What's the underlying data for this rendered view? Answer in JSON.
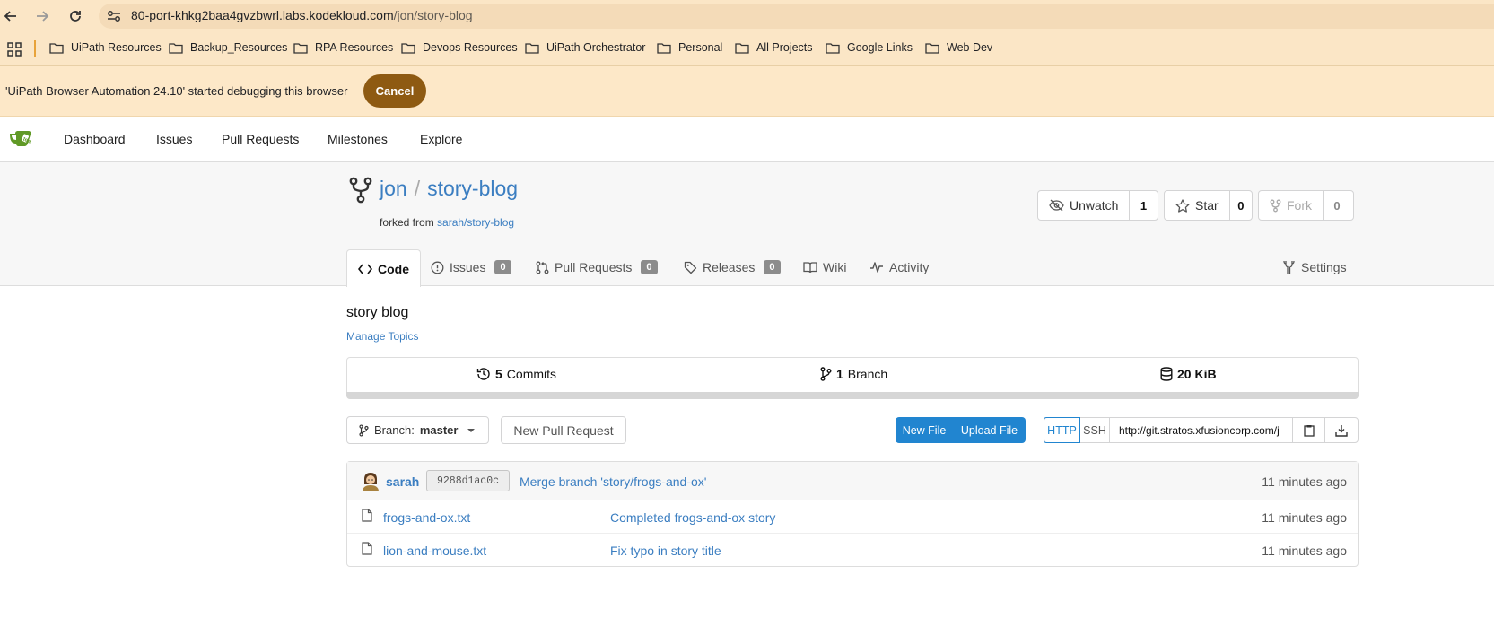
{
  "browser": {
    "url_host": "80-port-khkg2baa4gvzbwrl.labs.kodekloud.com",
    "url_path": "/jon/story-blog",
    "bookmarks": [
      {
        "label": "UiPath Resources"
      },
      {
        "label": "Backup_Resources"
      },
      {
        "label": "RPA Resources"
      },
      {
        "label": "Devops Resources"
      },
      {
        "label": "UiPath Orchestrator"
      },
      {
        "label": "Personal"
      },
      {
        "label": "All Projects"
      },
      {
        "label": "Google Links"
      },
      {
        "label": "Web Dev"
      }
    ],
    "infobar_text": "'UiPath Browser Automation 24.10' started debugging this browser",
    "infobar_cancel": "Cancel"
  },
  "nav": {
    "items": [
      "Dashboard",
      "Issues",
      "Pull Requests",
      "Milestones",
      "Explore"
    ]
  },
  "repo": {
    "owner": "jon",
    "name": "story-blog",
    "forked_prefix": "forked from",
    "forked_from": "sarah/story-blog",
    "unwatch_label": "Unwatch",
    "watch_count": "1",
    "star_label": "Star",
    "star_count": "0",
    "fork_label": "Fork",
    "fork_count": "0"
  },
  "tabs": {
    "code": "Code",
    "issues": "Issues",
    "issues_count": "0",
    "pulls": "Pull Requests",
    "pulls_count": "0",
    "releases": "Releases",
    "releases_count": "0",
    "wiki": "Wiki",
    "activity": "Activity",
    "settings": "Settings"
  },
  "summary": {
    "description": "story blog",
    "manage_topics": "Manage Topics",
    "commits_count": "5",
    "commits_label": "Commits",
    "branch_count": "1",
    "branch_label": "Branch",
    "size": "20 KiB"
  },
  "toolbar": {
    "branch_prefix": "Branch:",
    "branch_name": "master",
    "new_pr": "New Pull Request",
    "new_file": "New File",
    "upload_file": "Upload File",
    "http": "HTTP",
    "ssh": "SSH",
    "clone_url": "http://git.stratos.xfusioncorp.com/j"
  },
  "latest_commit": {
    "author": "sarah",
    "sha": "9288d1ac0c",
    "message": "Merge branch 'story/frogs-and-ox'",
    "time": "11 minutes ago"
  },
  "files": [
    {
      "name": "frogs-and-ox.txt",
      "message": "Completed frogs-and-ox story",
      "time": "11 minutes ago"
    },
    {
      "name": "lion-and-mouse.txt",
      "message": "Fix typo in story title",
      "time": "11 minutes ago"
    }
  ],
  "colors": {
    "link": "#3b7ec1",
    "primary": "#2185d0",
    "chrome": "#fbe6c6",
    "cancel": "#8e5a12",
    "logo": "#609926"
  }
}
